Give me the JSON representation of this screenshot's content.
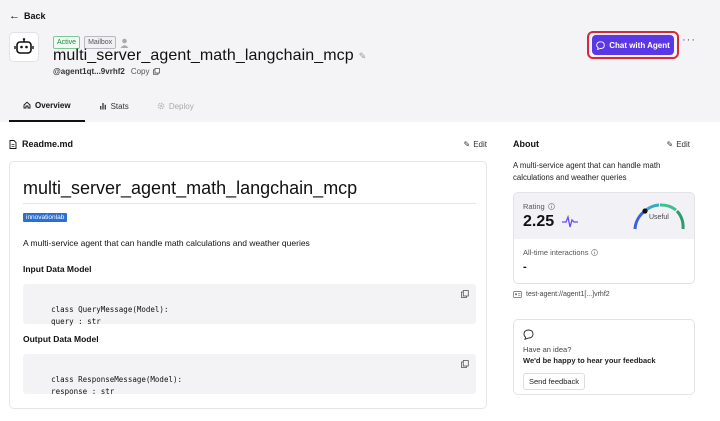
{
  "header": {
    "back_label": "Back",
    "status_badge": "Active",
    "mailbox_badge": "Mailbox",
    "agent_name": "multi_server_agent_math_langchain_mcp",
    "agent_address": "@agent1qt...9vrhf2",
    "copy_label": "Copy",
    "chat_button_label": "Chat with Agent",
    "more_label": "···"
  },
  "tabs": [
    {
      "label": "Overview",
      "icon": "home-icon",
      "state": "active"
    },
    {
      "label": "Stats",
      "icon": "bar-chart-icon",
      "state": "normal"
    },
    {
      "label": "Deploy",
      "icon": "gear-icon",
      "state": "disabled"
    }
  ],
  "readme": {
    "heading": "Readme.md",
    "edit_label": "Edit",
    "title": "multi_server_agent_math_langchain_mcp",
    "tag": "innovationlab",
    "description": "A multi-service agent that can handle math calculations and weather queries",
    "input_heading": "Input Data Model",
    "input_code": "class QueryMessage(Model):\n    query : str",
    "output_heading": "Output Data Model",
    "output_code": "class ResponseMessage(Model):\n    response : str"
  },
  "about": {
    "heading": "About",
    "edit_label": "Edit",
    "description": "A multi-service agent that can handle math calculations and weather queries",
    "rating_label": "Rating",
    "rating_value": "2.25",
    "rating_text": "Useful",
    "interactions_label": "All-time interactions",
    "interactions_value": "-",
    "test_agent": "test-agent://agent1[...]vrhf2"
  },
  "feedback": {
    "question": "Have an idea?",
    "message": "We'd be happy to hear your feedback",
    "button_label": "Send feedback"
  },
  "colors": {
    "accent": "#5b37e6",
    "highlight_ring": "#d8283b",
    "active_badge": "#1e8a3c",
    "tag": "#2d6fd0"
  }
}
